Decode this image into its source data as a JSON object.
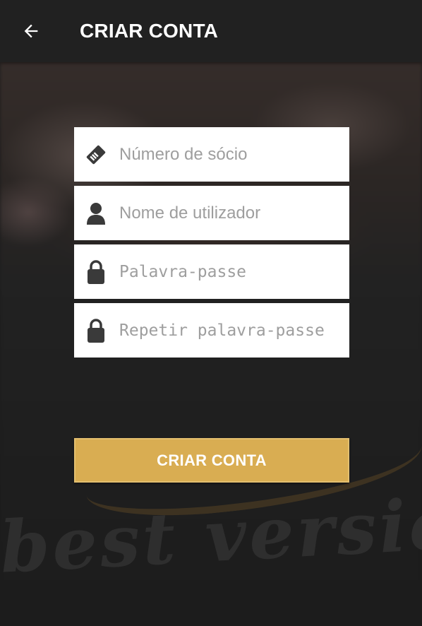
{
  "appbar": {
    "title": "CRIAR CONTA",
    "back_icon": "arrow-left-icon"
  },
  "form": {
    "fields": [
      {
        "icon": "membership-card-icon",
        "placeholder": "Número de sócio",
        "value": ""
      },
      {
        "icon": "user-icon",
        "placeholder": "Nome de utilizador",
        "value": ""
      },
      {
        "icon": "lock-icon",
        "placeholder": "Palavra-passe",
        "value": ""
      },
      {
        "icon": "lock-icon",
        "placeholder": "Repetir palavra-passe",
        "value": ""
      }
    ],
    "submit_label": "CRIAR CONTA"
  },
  "background": {
    "watermark_text": "best version"
  },
  "colors": {
    "appbar": "#212121",
    "accent": "#d9ad52",
    "field_bg": "#ffffff",
    "placeholder": "#9e9e9e",
    "icon": "#3a3a3a"
  }
}
